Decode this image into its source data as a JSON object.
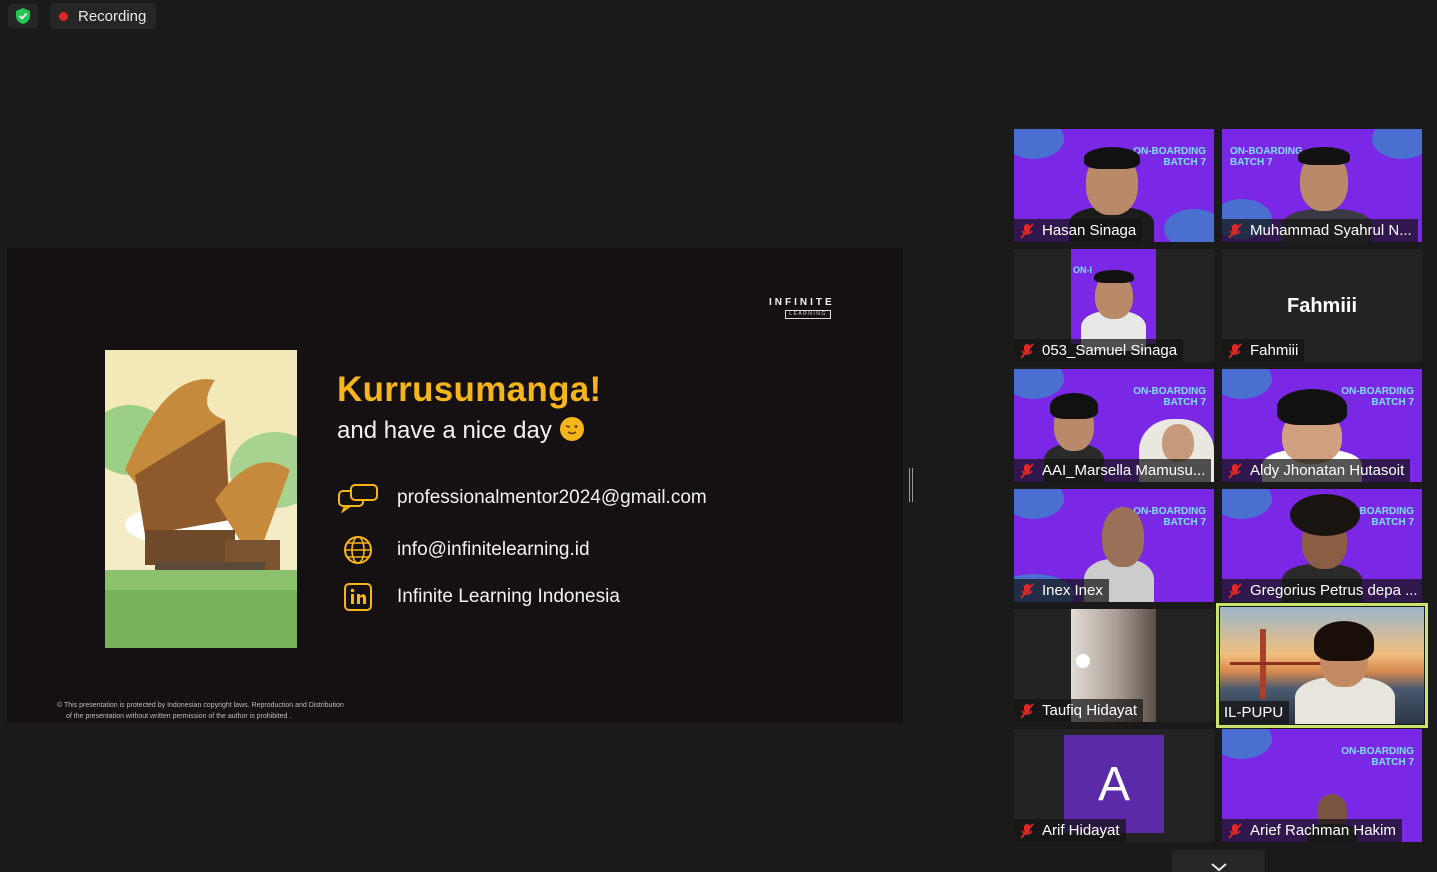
{
  "recording": {
    "label": "Recording"
  },
  "slide": {
    "logo_main": "INFINITE",
    "logo_sub": "LEARNING",
    "title": "Kurrusumanga!",
    "subtitle": "and have a nice day",
    "contacts": [
      {
        "icon": "chat-icon",
        "text": "professionalmentor2024@gmail.com"
      },
      {
        "icon": "globe-icon",
        "text": "info@infinitelearning.id"
      },
      {
        "icon": "linkedin-icon",
        "text": "Infinite Learning Indonesia"
      }
    ],
    "copyright_line1": "© This presentation is protected by Indonesian copyright laws. Reproduction and Distribution",
    "copyright_line2": "of the presentation without written permission of the author is prohibited ."
  },
  "participants": [
    {
      "name": "Hasan Sinaga",
      "type": "video-banner"
    },
    {
      "name": "Muhammad Syahrul N...",
      "type": "video-banner-mirror"
    },
    {
      "name": "053_Samuel Sinaga",
      "type": "video-small"
    },
    {
      "name": "Fahmiii",
      "type": "name-only",
      "display": "Fahmiii"
    },
    {
      "name": "AAI_Marsella Mamusu...",
      "type": "video-banner"
    },
    {
      "name": "Aldy Jhonatan Hutasoit",
      "type": "video-banner"
    },
    {
      "name": "Inex Inex",
      "type": "video-banner"
    },
    {
      "name": "Gregorius Petrus depa ...",
      "type": "video-banner"
    },
    {
      "name": "Taufiq Hidayat",
      "type": "video-dark"
    },
    {
      "name": "IL-PUPU",
      "type": "video-active"
    },
    {
      "name": "Arif Hidayat",
      "type": "avatar",
      "initial": "A"
    },
    {
      "name": "Arief Rachman Hakim",
      "type": "video-banner"
    }
  ],
  "banner": {
    "line1": "ON-BOARDING",
    "line2": "BATCH 7"
  },
  "colors": {
    "accent": "#f5b51b",
    "purple": "#7a27e6",
    "active_border": "#c9e36b",
    "mic_red": "#e02828"
  }
}
